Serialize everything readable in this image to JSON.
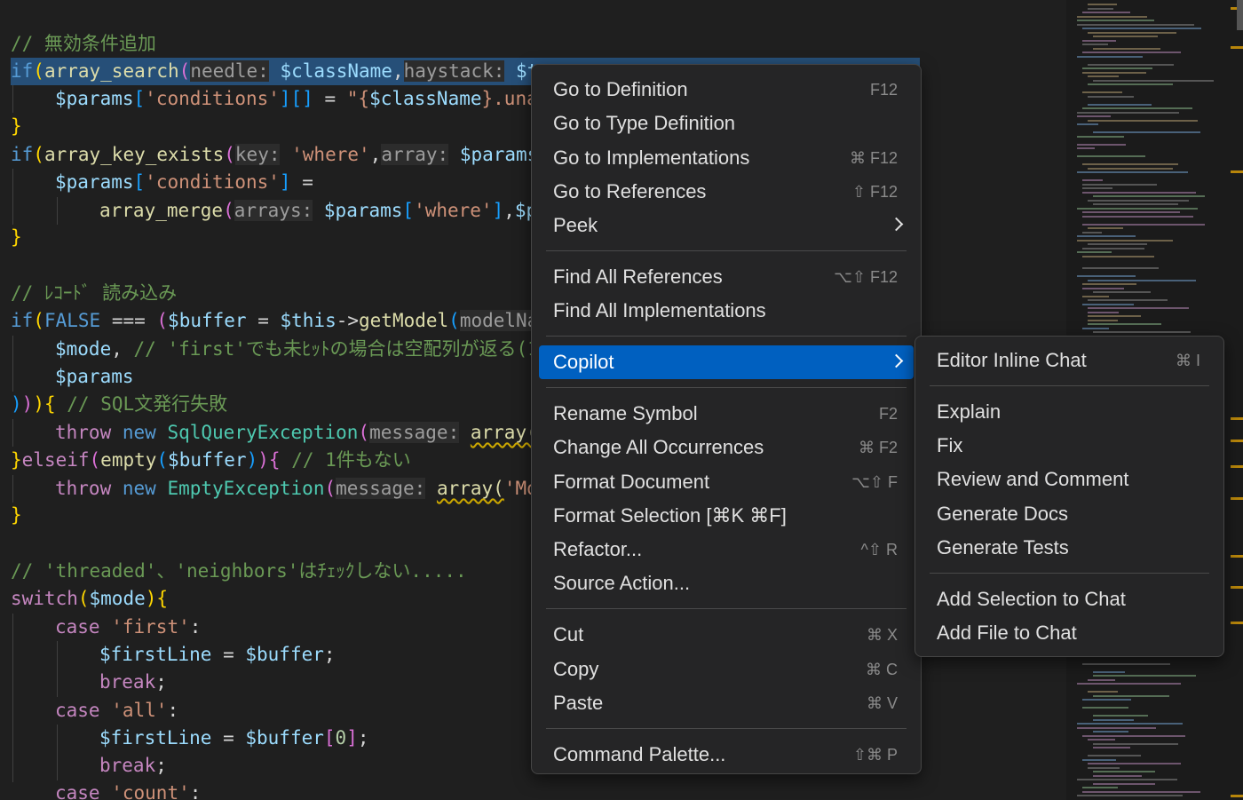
{
  "editor": {
    "lines": [
      [
        [
          "t-cm",
          "// 無効条件追加"
        ]
      ],
      [
        [
          "t-kw",
          "if"
        ],
        [
          "t-brk3",
          "("
        ],
        [
          "t-fn",
          "array_search"
        ],
        [
          "t-brk",
          "("
        ],
        [
          "t-hint",
          "needle:"
        ],
        [
          "t-pl",
          " "
        ],
        [
          "t-var",
          "$className"
        ],
        [
          "t-pl",
          ","
        ],
        [
          "t-hint",
          "haystack:"
        ],
        [
          "t-pl",
          " "
        ],
        [
          "t-var",
          "$t"
        ]
      ],
      [
        [
          "t-var",
          "$params"
        ],
        [
          "t-brk2",
          "["
        ],
        [
          "t-str",
          "'conditions'"
        ],
        [
          "t-brk2",
          "]"
        ],
        [
          "t-brk2",
          "[]"
        ],
        [
          "t-pl",
          " = "
        ],
        [
          "t-str",
          "\"{"
        ],
        [
          "t-var",
          "$className"
        ],
        [
          "t-str",
          "}.una"
        ]
      ],
      [
        [
          "t-brk3",
          "}"
        ]
      ],
      [
        [
          "t-kw",
          "if"
        ],
        [
          "t-brk3",
          "("
        ],
        [
          "t-fn",
          "array_key_exists"
        ],
        [
          "t-brk",
          "("
        ],
        [
          "t-hint",
          "key:"
        ],
        [
          "t-pl",
          " "
        ],
        [
          "t-str",
          "'where'"
        ],
        [
          "t-pl",
          ","
        ],
        [
          "t-hint",
          "array:"
        ],
        [
          "t-pl",
          " "
        ],
        [
          "t-var",
          "$params"
        ]
      ],
      [
        [
          "t-var",
          "$params"
        ],
        [
          "t-brk2",
          "["
        ],
        [
          "t-str",
          "'conditions'"
        ],
        [
          "t-brk2",
          "]"
        ],
        [
          "t-pl",
          " ="
        ]
      ],
      [
        [
          "t-fn",
          "array_merge"
        ],
        [
          "t-brk",
          "("
        ],
        [
          "t-hint",
          "arrays:"
        ],
        [
          "t-pl",
          " "
        ],
        [
          "t-var",
          "$params"
        ],
        [
          "t-brk2",
          "["
        ],
        [
          "t-str",
          "'where'"
        ],
        [
          "t-brk2",
          "]"
        ],
        [
          "t-pl",
          ","
        ],
        [
          "t-var",
          "$p"
        ]
      ],
      [
        [
          "t-brk3",
          "}"
        ]
      ],
      [],
      [
        [
          "t-cm",
          "// ﾚｺｰﾄﾞ 読み込み"
        ]
      ],
      [
        [
          "t-kw",
          "if"
        ],
        [
          "t-brk3",
          "("
        ],
        [
          "t-kw",
          "FALSE"
        ],
        [
          "t-pl",
          " === "
        ],
        [
          "t-brk",
          "("
        ],
        [
          "t-var",
          "$buffer"
        ],
        [
          "t-pl",
          " = "
        ],
        [
          "t-var",
          "$this"
        ],
        [
          "t-pl",
          "->"
        ],
        [
          "t-fn",
          "getModel"
        ],
        [
          "t-brk2",
          "("
        ],
        [
          "t-hint",
          "modelNa"
        ]
      ],
      [
        [
          "t-var",
          "$mode"
        ],
        [
          "t-pl",
          ", "
        ],
        [
          "t-cm",
          "// 'first'でも未ﾋｯﾄの場合は空配列が返る(1"
        ]
      ],
      [
        [
          "t-var",
          "$params"
        ]
      ],
      [
        [
          "t-brk2",
          ")"
        ],
        [
          "t-brk",
          ")"
        ],
        [
          "t-brk3",
          ")"
        ],
        [
          "t-brk3",
          "{"
        ],
        [
          "t-pl",
          " "
        ],
        [
          "t-cm",
          "// SQL文発行失敗"
        ]
      ],
      [
        [
          "t-kw2",
          "throw"
        ],
        [
          "t-pl",
          " "
        ],
        [
          "t-kw",
          "new"
        ],
        [
          "t-pl",
          " "
        ],
        [
          "t-cls",
          "SqlQueryException"
        ],
        [
          "t-brk",
          "("
        ],
        [
          "t-hint",
          "message:"
        ],
        [
          "t-pl",
          " "
        ],
        [
          "t-fn t-warn",
          "array("
        ]
      ],
      [
        [
          "t-brk3",
          "}"
        ],
        [
          "t-kw2",
          "elseif"
        ],
        [
          "t-brk",
          "("
        ],
        [
          "t-fn",
          "empty"
        ],
        [
          "t-brk2",
          "("
        ],
        [
          "t-var",
          "$buffer"
        ],
        [
          "t-brk2",
          ")"
        ],
        [
          "t-brk",
          ")"
        ],
        [
          "t-brk",
          "{"
        ],
        [
          "t-pl",
          " "
        ],
        [
          "t-cm",
          "// 1件もない"
        ]
      ],
      [
        [
          "t-kw2",
          "throw"
        ],
        [
          "t-pl",
          " "
        ],
        [
          "t-kw",
          "new"
        ],
        [
          "t-pl",
          " "
        ],
        [
          "t-cls",
          "EmptyException"
        ],
        [
          "t-brk",
          "("
        ],
        [
          "t-hint",
          "message:"
        ],
        [
          "t-pl",
          " "
        ],
        [
          "t-fn t-warn",
          "array("
        ],
        [
          "t-str",
          "'Mo"
        ]
      ],
      [
        [
          "t-brk3",
          "}"
        ]
      ],
      [],
      [
        [
          "t-cm",
          "// 'threaded'、'neighbors'はﾁｪｯｸしない....."
        ]
      ],
      [
        [
          "t-kw2",
          "switch"
        ],
        [
          "t-brk3",
          "("
        ],
        [
          "t-var",
          "$mode"
        ],
        [
          "t-brk3",
          ")"
        ],
        [
          "t-brk3",
          "{"
        ]
      ],
      [
        [
          "t-kw2",
          "case"
        ],
        [
          "t-pl",
          " "
        ],
        [
          "t-str",
          "'first'"
        ],
        [
          "t-pl",
          ":"
        ]
      ],
      [
        [
          "t-var",
          "$firstLine"
        ],
        [
          "t-pl",
          " = "
        ],
        [
          "t-var",
          "$buffer"
        ],
        [
          "t-pl",
          ";"
        ]
      ],
      [
        [
          "t-kw2",
          "break"
        ],
        [
          "t-pl",
          ";"
        ]
      ],
      [
        [
          "t-kw2",
          "case"
        ],
        [
          "t-pl",
          " "
        ],
        [
          "t-str",
          "'all'"
        ],
        [
          "t-pl",
          ":"
        ]
      ],
      [
        [
          "t-var",
          "$firstLine"
        ],
        [
          "t-pl",
          " = "
        ],
        [
          "t-var",
          "$buffer"
        ],
        [
          "t-brk",
          "["
        ],
        [
          "t-num",
          "0"
        ],
        [
          "t-brk",
          "]"
        ],
        [
          "t-pl",
          ";"
        ]
      ],
      [
        [
          "t-kw2",
          "break"
        ],
        [
          "t-pl",
          ";"
        ]
      ],
      [
        [
          "t-kw2",
          "case"
        ],
        [
          "t-pl",
          " "
        ],
        [
          "t-str",
          "'count'"
        ],
        [
          "t-pl",
          ":"
        ]
      ]
    ]
  },
  "context_menu": {
    "items": [
      {
        "label": "Go to Definition",
        "shortcut": "F12",
        "interactable": true
      },
      {
        "label": "Go to Type Definition",
        "shortcut": "",
        "interactable": true
      },
      {
        "label": "Go to Implementations",
        "shortcut": "⌘ F12",
        "interactable": true
      },
      {
        "label": "Go to References",
        "shortcut": "⇧ F12",
        "interactable": true
      },
      {
        "label": "Peek",
        "shortcut": "",
        "submenu": true,
        "interactable": true
      },
      {
        "separator": true
      },
      {
        "label": "Find All References",
        "shortcut": "⌥⇧ F12",
        "interactable": true
      },
      {
        "label": "Find All Implementations",
        "shortcut": "",
        "interactable": true
      },
      {
        "separator": true
      },
      {
        "label": "Copilot",
        "shortcut": "",
        "submenu": true,
        "active": true,
        "interactable": true
      },
      {
        "separator": true
      },
      {
        "label": "Rename Symbol",
        "shortcut": "F2",
        "interactable": true
      },
      {
        "label": "Change All Occurrences",
        "shortcut": "⌘ F2",
        "interactable": true
      },
      {
        "label": "Format Document",
        "shortcut": "⌥⇧ F",
        "interactable": true
      },
      {
        "label": "Format Selection [⌘K ⌘F]",
        "shortcut": "",
        "interactable": true
      },
      {
        "label": "Refactor...",
        "shortcut": "^⇧ R",
        "interactable": true
      },
      {
        "label": "Source Action...",
        "shortcut": "",
        "interactable": true
      },
      {
        "separator": true
      },
      {
        "label": "Cut",
        "shortcut": "⌘ X",
        "interactable": true
      },
      {
        "label": "Copy",
        "shortcut": "⌘ C",
        "interactable": true
      },
      {
        "label": "Paste",
        "shortcut": "⌘ V",
        "interactable": true
      },
      {
        "separator": true
      },
      {
        "label": "Command Palette...",
        "shortcut": "⇧⌘ P",
        "interactable": true
      }
    ]
  },
  "copilot_submenu": {
    "items": [
      {
        "label": "Editor Inline Chat",
        "shortcut": "⌘ I",
        "interactable": true
      },
      {
        "separator": true
      },
      {
        "label": "Explain",
        "shortcut": "",
        "interactable": true
      },
      {
        "label": "Fix",
        "shortcut": "",
        "interactable": true
      },
      {
        "label": "Review and Comment",
        "shortcut": "",
        "interactable": true
      },
      {
        "label": "Generate Docs",
        "shortcut": "",
        "interactable": true
      },
      {
        "label": "Generate Tests",
        "shortcut": "",
        "interactable": true
      },
      {
        "separator": true
      },
      {
        "label": "Add Selection to Chat",
        "shortcut": "",
        "interactable": true
      },
      {
        "label": "Add File to Chat",
        "shortcut": "",
        "interactable": true
      }
    ]
  },
  "theme": {
    "editor_bg": "#1f1f1f",
    "menu_bg": "#252526",
    "menu_active": "#0060c0",
    "selection": "#264f78"
  }
}
